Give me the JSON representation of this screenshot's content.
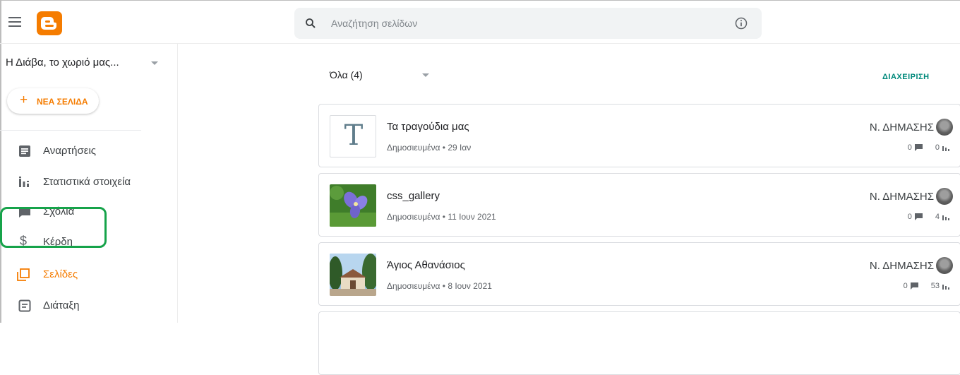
{
  "header": {
    "menu_icon": "hamburger-menu-icon",
    "logo": "blogger-logo",
    "search_placeholder": "Αναζήτηση σελίδων",
    "search_icon": "search-icon",
    "info_icon": "info-icon"
  },
  "sidebar": {
    "blog_name": "Η Διάβα, το χωριό μας...",
    "new_page_label": "ΝΕΑ ΣΕΛΙΔΑ",
    "items": [
      {
        "label": "Αναρτήσεις",
        "icon": "posts-icon",
        "active": false
      },
      {
        "label": "Στατιστικά στοιχεία",
        "icon": "stats-icon",
        "active": false
      },
      {
        "label": "Σχόλια",
        "icon": "comments-icon",
        "active": false
      },
      {
        "label": "Κέρδη",
        "icon": "dollar-icon",
        "active": false
      },
      {
        "label": "Σελίδες",
        "icon": "pages-icon",
        "active": true
      },
      {
        "label": "Διάταξη",
        "icon": "layout-icon",
        "active": false
      }
    ]
  },
  "main": {
    "filter_label": "Όλα (4)",
    "manage_label": "ΔΙΑΧΕΙΡΙΣΗ",
    "pages": [
      {
        "title": "Τα τραγούδια μας",
        "status": "Δημοσιευμένα • 29 Ιαν",
        "author": "Ν. ΔΗΜΑΣΗΣ",
        "comments": "0",
        "views": "0",
        "thumb": "text"
      },
      {
        "title": "css_gallery",
        "status": "Δημοσιευμένα • 11 Ιουν 2021",
        "author": "Ν. ΔΗΜΑΣΗΣ",
        "comments": "0",
        "views": "4",
        "thumb": "flower"
      },
      {
        "title": "Άγιος Αθανάσιος",
        "status": "Δημοσιευμένα • 8 Ιουν 2021",
        "author": "Ν. ΔΗΜΑΣΗΣ",
        "comments": "0",
        "views": "53",
        "thumb": "church"
      }
    ]
  },
  "colors": {
    "accent": "#f57c00",
    "manage": "#00897b",
    "highlight": "#16a34a"
  }
}
